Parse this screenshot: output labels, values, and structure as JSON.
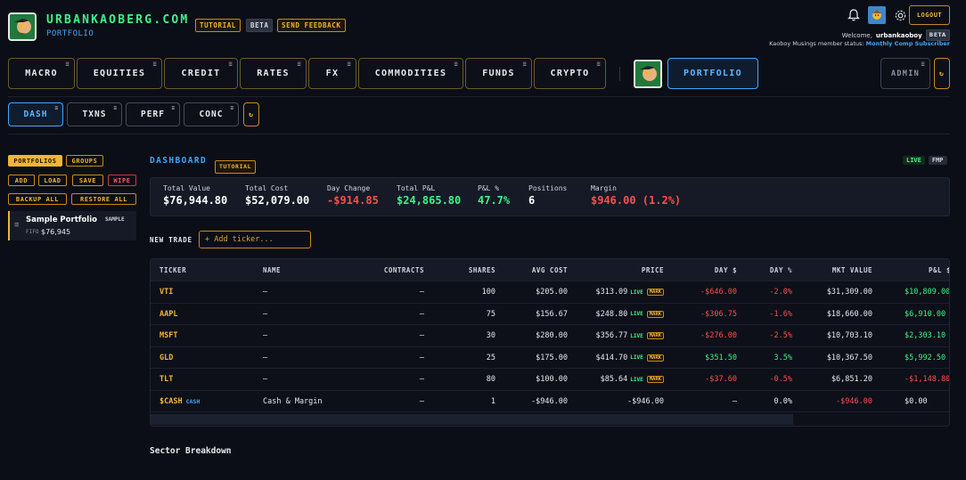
{
  "header": {
    "brand": "URBANKAOBERG.COM",
    "subtitle": "PORTFOLIO",
    "badges": {
      "tutorial": "TUTORIAL",
      "beta": "BETA",
      "feedback": "SEND FEEDBACK"
    },
    "logout": "LOGOUT",
    "welcome_prefix": "Welcome,",
    "username": "urbankaoboy",
    "user_badge": "BETA",
    "member_prefix": "Kaoboy Musings member status:",
    "member_status": "Monthly Comp Subscriber"
  },
  "nav": {
    "items": [
      "MACRO",
      "EQUITIES",
      "CREDIT",
      "RATES",
      "FX",
      "COMMODITIES",
      "FUNDS",
      "CRYPTO"
    ],
    "active": "PORTFOLIO",
    "admin": "ADMIN",
    "refresh": "↻"
  },
  "subnav": {
    "items": [
      "DASH",
      "TXNS",
      "PERF",
      "CONC"
    ],
    "refresh": "↻"
  },
  "sidebar": {
    "tabs": {
      "portfolios": "PORTFOLIOS",
      "groups": "GROUPS"
    },
    "actions": {
      "add": "ADD",
      "load": "LOAD",
      "save": "SAVE",
      "wipe": "WIPE",
      "backup": "BACKUP ALL",
      "restore": "RESTORE ALL"
    },
    "portfolio": {
      "name": "Sample Portfolio",
      "tag": "SAMPLE",
      "method": "FIFO",
      "value": "$76,945"
    }
  },
  "dashboard": {
    "title": "DASHBOARD",
    "tutorial": "TUTORIAL",
    "live": "LIVE",
    "source": "FMP",
    "metrics": {
      "total_value": {
        "label": "Total Value",
        "value": "$76,944.80"
      },
      "total_cost": {
        "label": "Total Cost",
        "value": "$52,079.00"
      },
      "day_change": {
        "label": "Day Change",
        "value": "-$914.85"
      },
      "total_pl": {
        "label": "Total P&L",
        "value": "$24,865.80"
      },
      "pl_pct": {
        "label": "P&L %",
        "value": "47.7%"
      },
      "positions": {
        "label": "Positions",
        "value": "6"
      },
      "margin": {
        "label": "Margin",
        "value": "$946.00 (1.2%)"
      }
    },
    "new_trade": {
      "label": "NEW TRADE",
      "placeholder": "+ Add ticker..."
    },
    "section": "Sector Breakdown"
  },
  "table": {
    "headers": {
      "ticker": "TICKER",
      "name": "NAME",
      "contracts": "CONTRACTS",
      "shares": "SHARES",
      "avg_cost": "AVG COST",
      "price": "PRICE",
      "day_d": "DAY $",
      "day_p": "DAY %",
      "mkt_value": "MKT VALUE",
      "pl": "P&L $"
    },
    "live_tag": "LIVE",
    "mark_tag": "MARK",
    "cash_tag": "CASH",
    "rows": [
      {
        "ticker": "VTI",
        "name": "—",
        "contracts": "—",
        "shares": "100",
        "avg_cost": "$205.00",
        "price": "$313.09",
        "day_d": "-$646.00",
        "day_p": "-2.0%",
        "mkt_value": "$31,309.00",
        "pl": "$10,809.00"
      },
      {
        "ticker": "AAPL",
        "name": "—",
        "contracts": "—",
        "shares": "75",
        "avg_cost": "$156.67",
        "price": "$248.80",
        "day_d": "-$306.75",
        "day_p": "-1.6%",
        "mkt_value": "$18,660.00",
        "pl": "$6,910.00"
      },
      {
        "ticker": "MSFT",
        "name": "—",
        "contracts": "—",
        "shares": "30",
        "avg_cost": "$280.00",
        "price": "$356.77",
        "day_d": "-$276.00",
        "day_p": "-2.5%",
        "mkt_value": "$10,703.10",
        "pl": "$2,303.10"
      },
      {
        "ticker": "GLD",
        "name": "—",
        "contracts": "—",
        "shares": "25",
        "avg_cost": "$175.00",
        "price": "$414.70",
        "day_d": "$351.50",
        "day_p": "3.5%",
        "mkt_value": "$10,367.50",
        "pl": "$5,992.50"
      },
      {
        "ticker": "TLT",
        "name": "—",
        "contracts": "—",
        "shares": "80",
        "avg_cost": "$100.00",
        "price": "$85.64",
        "day_d": "-$37.60",
        "day_p": "-0.5%",
        "mkt_value": "$6,851.20",
        "pl": "-$1,148.80"
      },
      {
        "ticker": "$CASH",
        "name": "Cash & Margin",
        "contracts": "—",
        "shares": "1",
        "avg_cost": "-$946.00",
        "price": "-$946.00",
        "day_d": "—",
        "day_p": "0.0%",
        "mkt_value": "-$946.00",
        "pl": "$0.00"
      }
    ]
  },
  "colors": {
    "accent": "#f2b632",
    "blue": "#3fa7ff",
    "green": "#3df58a",
    "red": "#ff4d4d",
    "bg": "#0b0e16"
  }
}
